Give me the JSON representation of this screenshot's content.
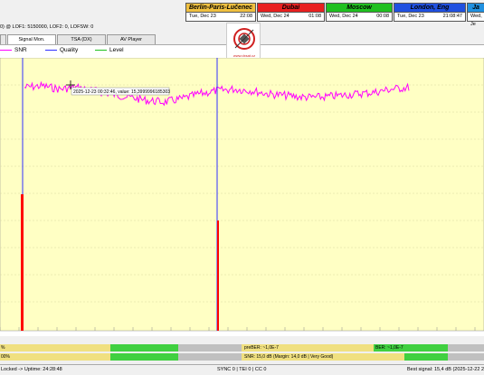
{
  "info_line": "0) @ LOF1: 5150000, LOF2: 0, LOFSW: 0",
  "clocks": [
    {
      "zone": "Berlin-Paris-Lučenec",
      "date": "Tue, Dec 23",
      "time": "22:08",
      "color": "#f0c040"
    },
    {
      "zone": "Dubai",
      "date": "Wed, Dec 24",
      "time": "01:08",
      "color": "#e82020"
    },
    {
      "zone": "Moscow",
      "date": "Wed, Dec 24",
      "time": "00:08",
      "color": "#20c020"
    },
    {
      "zone": "London, Eng",
      "date": "Tue, Dec 23",
      "time": "21:08:47",
      "color": "#2050e0"
    },
    {
      "zone": "Ja",
      "date": "Wed, Je",
      "time": "",
      "color": "#2090e0"
    }
  ],
  "tabs": [
    {
      "label": "",
      "active": false
    },
    {
      "label": "Signal Mon.",
      "active": true
    },
    {
      "label": "TSA (DX)",
      "active": false
    },
    {
      "label": "AV Player",
      "active": false
    }
  ],
  "logo_text": "www.dxsat.cz",
  "legend": [
    {
      "label": "SNR",
      "color": "#ff00ff"
    },
    {
      "label": "Quality",
      "color": "#3030ff"
    },
    {
      "label": "Level",
      "color": "#20c020"
    }
  ],
  "tooltip": "2025-12-23 00:32:46, value: 15,3999996185303",
  "chart_data": {
    "type": "line",
    "title": "",
    "xlabel": "",
    "ylabel": "",
    "series": [
      {
        "name": "SNR",
        "color": "#ff00ff",
        "values": [
          15.4,
          15.5,
          15.3,
          15.4,
          15.2,
          15.0,
          14.8,
          14.6,
          14.5,
          14.7,
          15.0,
          15.2,
          15.3,
          15.2,
          15.0,
          14.9,
          14.8,
          14.8,
          14.9,
          15.0,
          15.1,
          15.3,
          15.4
        ]
      }
    ],
    "markers": [
      {
        "label": "red-spike-1"
      },
      {
        "label": "red-spike-2"
      }
    ]
  },
  "bars": {
    "row1_left": "%",
    "row2_left": "00%",
    "preber": "preBER: ~1,0E-7",
    "ber": "BER: ~1,0E-7",
    "snr_status": "SNR: 15,0 dB (Margin: 14,0 dB | Very Good)"
  },
  "status": {
    "left": "Locked -> Uptime: 24:28:48",
    "middle": "SYNC 0 | TEI 0 | CC 0",
    "right": "Best signal: 15,4 dB (2025-12-22 23"
  }
}
